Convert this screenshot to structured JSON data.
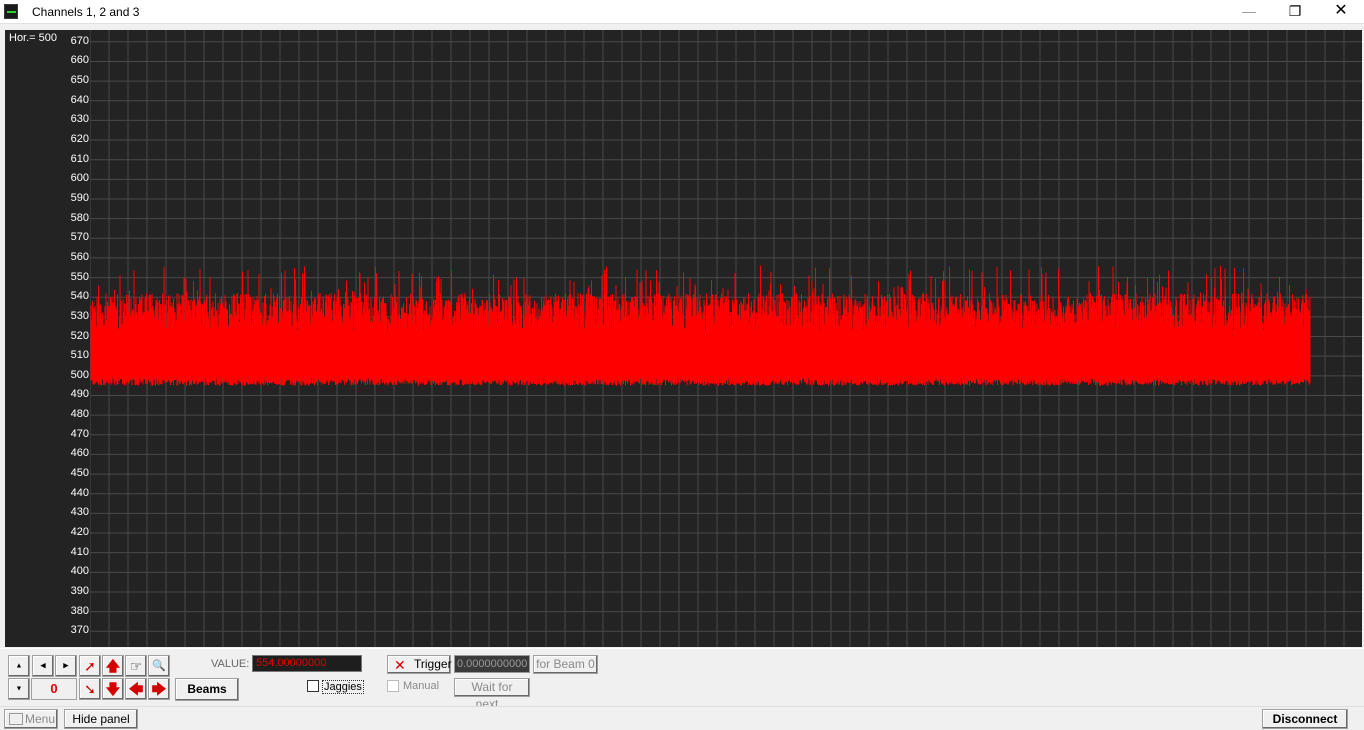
{
  "window": {
    "title": "Channels 1, 2 and 3",
    "minimize_glyph": "—",
    "maximize_glyph": "❐",
    "close_glyph": "✕"
  },
  "scope": {
    "hor_label": "Hor.= 500",
    "background": "#232323",
    "grid_color": "#4a4a4a",
    "trace_color": "#ff0000",
    "y_ticks": [
      670,
      660,
      650,
      640,
      630,
      620,
      610,
      600,
      590,
      580,
      570,
      560,
      550,
      540,
      530,
      520,
      510,
      500,
      490,
      480,
      470,
      460,
      450,
      440,
      430,
      420,
      410,
      400,
      390,
      380,
      370
    ]
  },
  "chart_data": {
    "type": "line",
    "series": [
      {
        "values_min": 495,
        "values_max": 556,
        "typical_low": 497,
        "typical_high": 542
      }
    ],
    "ylim": [
      362,
      676
    ],
    "grid": true
  },
  "controls": {
    "value_label": "VALUE:",
    "value": "554.00000000",
    "counter": "0",
    "beams_label": "Beams",
    "jaggies_label": "Jaggies",
    "trigger_label": "Trigger",
    "trigger_value": "0.0000000000",
    "for_beam_label": "for Beam 0",
    "manual_label": "Manual",
    "wait_label": "Wait for next..."
  },
  "status": {
    "menu_label": "Menu",
    "hide_panel_label": "Hide panel",
    "disconnect_label": "Disconnect"
  },
  "icons": {
    "arrow_up_right": "➚",
    "arrow_up": "🡅",
    "arrow_down": "🡇",
    "arrow_down_left": "➘",
    "arrow_left": "🡄",
    "arrow_right": "🡆",
    "zoom": "🔍",
    "hand": "☞",
    "tri_up": "▲",
    "tri_down": "▼",
    "tri_left": "◀",
    "tri_right": "▶",
    "trigger_x": "✕"
  }
}
